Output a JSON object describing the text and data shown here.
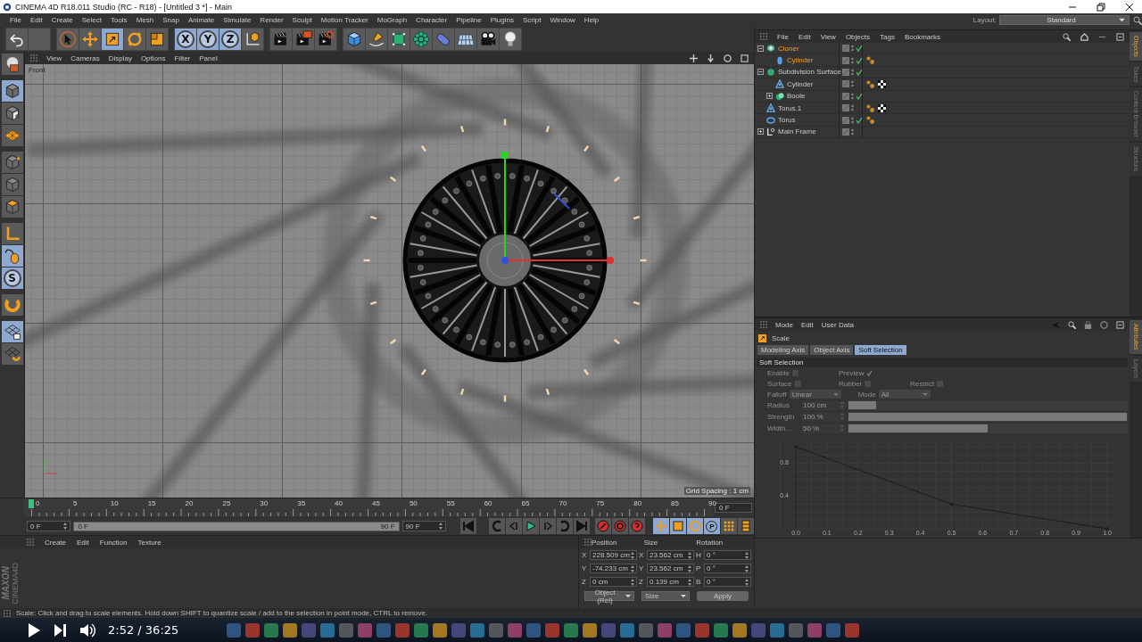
{
  "window": {
    "title": "CINEMA 4D R18.011 Studio (RC - R18) - [Untitled 3 *] - Main"
  },
  "menu": [
    "File",
    "Edit",
    "Create",
    "Select",
    "Tools",
    "Mesh",
    "Snap",
    "Animate",
    "Simulate",
    "Render",
    "Sculpt",
    "Motion Tracker",
    "MoGraph",
    "Character",
    "Pipeline",
    "Plugins",
    "Script",
    "Window",
    "Help"
  ],
  "layout": {
    "label": "Layout:",
    "value": "Standard"
  },
  "tools": [
    {
      "kind": "undo",
      "on": false
    },
    {
      "kind": "redo",
      "on": false
    },
    {
      "kind": "select",
      "on": false
    },
    {
      "kind": "move",
      "on": false
    },
    {
      "kind": "scale",
      "on": true
    },
    {
      "kind": "rotate",
      "on": false
    },
    {
      "kind": "transform",
      "on": false
    },
    {
      "kind": "axis",
      "label": "X",
      "on": true
    },
    {
      "kind": "axis",
      "label": "Y",
      "on": true
    },
    {
      "kind": "axis",
      "label": "Z",
      "on": true
    },
    {
      "kind": "world",
      "on": false
    },
    {
      "kind": "render-view",
      "on": false
    },
    {
      "kind": "render-picture",
      "on": false
    },
    {
      "kind": "render-settings",
      "on": false
    },
    {
      "kind": "cube",
      "on": false
    },
    {
      "kind": "pen",
      "on": false
    },
    {
      "kind": "subdivision",
      "on": false
    },
    {
      "kind": "cloner",
      "on": false
    },
    {
      "kind": "deformer",
      "on": false
    },
    {
      "kind": "floor",
      "on": false
    },
    {
      "kind": "camera",
      "on": false
    },
    {
      "kind": "light",
      "on": false
    }
  ],
  "side_tools": [
    {
      "kind": "make-editable",
      "on": false
    },
    {
      "kind": "model",
      "on": true
    },
    {
      "kind": "texture",
      "on": false
    },
    {
      "kind": "workplane",
      "on": false
    },
    {
      "kind": "points",
      "on": false
    },
    {
      "kind": "edges",
      "on": false
    },
    {
      "kind": "polygons",
      "on": false
    },
    {
      "kind": "axis",
      "on": false
    },
    {
      "kind": "tweak",
      "on": true
    },
    {
      "kind": "solo",
      "label": "S",
      "on": true
    },
    {
      "kind": "magnet",
      "on": false
    },
    {
      "kind": "lock",
      "on": true
    },
    {
      "kind": "snap",
      "on": false
    }
  ],
  "viewport": {
    "menu": [
      "View",
      "Cameras",
      "Display",
      "Options",
      "Filter",
      "Panel"
    ],
    "view_name": "Front",
    "grid_label": "Grid Spacing : 1 cm"
  },
  "timeline": {
    "ticks": [
      "0",
      "5",
      "10",
      "15",
      "20",
      "25",
      "30",
      "35",
      "40",
      "45",
      "50",
      "55",
      "60",
      "65",
      "70",
      "75",
      "80",
      "85",
      "90"
    ],
    "level": 0,
    "current_frame": "0 F"
  },
  "transport": {
    "start": "0 F",
    "range": {
      "start": "0 F",
      "end": "90 F",
      "level": 1
    },
    "end": "90 F",
    "buttons": [
      {
        "kind": "first"
      },
      {
        "kind": "prev-key"
      },
      {
        "kind": "prev-frame"
      },
      {
        "kind": "play"
      },
      {
        "kind": "next-frame"
      },
      {
        "kind": "next-key"
      },
      {
        "kind": "last"
      },
      {
        "kind": "record"
      },
      {
        "kind": "autokey"
      },
      {
        "kind": "keyframe-selection"
      }
    ],
    "key_buttons": [
      {
        "kind": "position",
        "on": true
      },
      {
        "kind": "scale",
        "on": true
      },
      {
        "kind": "rotation",
        "on": true
      },
      {
        "kind": "parameter",
        "label": "P",
        "on": true
      },
      {
        "kind": "point-level",
        "on": false
      },
      {
        "kind": "timeline",
        "on": false
      }
    ]
  },
  "materials": {
    "menu": [
      "Create",
      "Edit",
      "Function",
      "Texture"
    ]
  },
  "logo": {
    "brand": "MAXON",
    "product": "CINEMA4D"
  },
  "coords": {
    "headers": [
      "Position",
      "Size",
      "Rotation"
    ],
    "rows": [
      [
        {
          "axis": "X",
          "value": "228.509 cm"
        },
        {
          "axis": "X",
          "value": "23.562 cm"
        },
        {
          "axis": "H",
          "value": "0 °"
        }
      ],
      [
        {
          "axis": "Y",
          "value": "-74.233 cm"
        },
        {
          "axis": "Y",
          "value": "23.562 cm"
        },
        {
          "axis": "P",
          "value": "0 °"
        }
      ],
      [
        {
          "axis": "Z",
          "value": "0 cm"
        },
        {
          "axis": "Z",
          "value": "0.139 cm"
        },
        {
          "axis": "B",
          "value": "0 °"
        }
      ]
    ],
    "mode": "Object (Rel)",
    "size_mode": "Size",
    "apply": "Apply"
  },
  "objects": {
    "menu": [
      "File",
      "Edit",
      "View",
      "Objects",
      "Tags",
      "Bookmarks"
    ],
    "tree": [
      {
        "name": "Cloner",
        "kind": "cloner",
        "selected": true,
        "enabled": true,
        "expanded": true,
        "children": [
          {
            "name": "Cylinder",
            "kind": "cylinder",
            "selected": true,
            "enabled": true,
            "tags": [
              {
                "kind": "phong"
              }
            ]
          }
        ]
      },
      {
        "name": "Subdivision Surface",
        "kind": "subdivision",
        "selected": false,
        "enabled": true,
        "expanded": true,
        "children": [
          {
            "name": "Cylinder",
            "kind": "polygon",
            "selected": false,
            "enabled": false,
            "tags": [
              {
                "kind": "phong"
              },
              {
                "kind": "material"
              }
            ]
          },
          {
            "name": "Boole",
            "kind": "boole",
            "selected": false,
            "enabled": true,
            "expanded": false
          }
        ]
      },
      {
        "name": "Torus.1",
        "kind": "polygon",
        "selected": false,
        "enabled": false,
        "tags": [
          {
            "kind": "phong"
          },
          {
            "kind": "material"
          }
        ]
      },
      {
        "name": "Torus",
        "kind": "torus",
        "selected": false,
        "enabled": true,
        "tags": [
          {
            "kind": "phong"
          }
        ]
      },
      {
        "name": "Main Frame",
        "kind": "null",
        "selected": false,
        "enabled": false,
        "expanded": false
      }
    ],
    "side_tabs": [
      {
        "label": "Objects",
        "selected": true
      },
      {
        "label": "Takes",
        "selected": false
      },
      {
        "label": "Content Browser",
        "selected": false
      },
      {
        "label": "Structure",
        "selected": false
      }
    ]
  },
  "attributes": {
    "menu": [
      "Mode",
      "Edit",
      "User Data"
    ],
    "tool": "Scale",
    "tabs": [
      {
        "label": "Modeling Axis",
        "selected": false
      },
      {
        "label": "Object Axis",
        "selected": false
      },
      {
        "label": "Soft Selection",
        "selected": true
      }
    ],
    "section": "Soft Selection",
    "check_rows": [
      [
        {
          "label": "Enable",
          "checked": false
        },
        {
          "label": "Preview",
          "checked": true
        }
      ],
      [
        {
          "label": "Surface",
          "checked": false
        },
        {
          "label": "Rubber",
          "checked": false
        },
        {
          "label": "Restrict",
          "checked": false
        }
      ]
    ],
    "dropdowns": [
      {
        "label": "Falloff",
        "value": "Linear"
      },
      {
        "label": "Mode",
        "value": "All"
      }
    ],
    "sliders": [
      {
        "label": "Radius",
        "value": "100 cm",
        "level": 0.1
      },
      {
        "label": "Strength",
        "value": "100 %",
        "level": 1
      },
      {
        "label": "Width...",
        "value": "50 %",
        "level": 0.5
      }
    ],
    "chart_data": {
      "type": "line",
      "x": [
        0,
        0.5,
        1
      ],
      "series": [
        {
          "color": "#1c1c1c",
          "values": [
            1,
            0.3,
            0
          ]
        }
      ],
      "xlim": [
        0,
        1
      ],
      "ylim": [
        0,
        1
      ],
      "xticks": [
        {
          "value": 0,
          "label": "0.0"
        },
        0.1,
        0.2,
        0.3,
        0.4,
        0.5,
        0.6,
        0.7,
        0.8,
        0.9,
        {
          "value": 1,
          "label": "1.0"
        }
      ],
      "yticks": [
        0.4,
        0.8
      ],
      "grid": true
    },
    "side_tabs": [
      {
        "label": "Attributes",
        "selected": true
      },
      {
        "label": "Layers",
        "selected": false
      }
    ]
  },
  "status": "Scale: Click and drag to scale elements. Hold down SHIFT to quantize scale / add to the selection in point mode, CTRL to remove.",
  "player": {
    "time": "2:52 / 36:25"
  }
}
